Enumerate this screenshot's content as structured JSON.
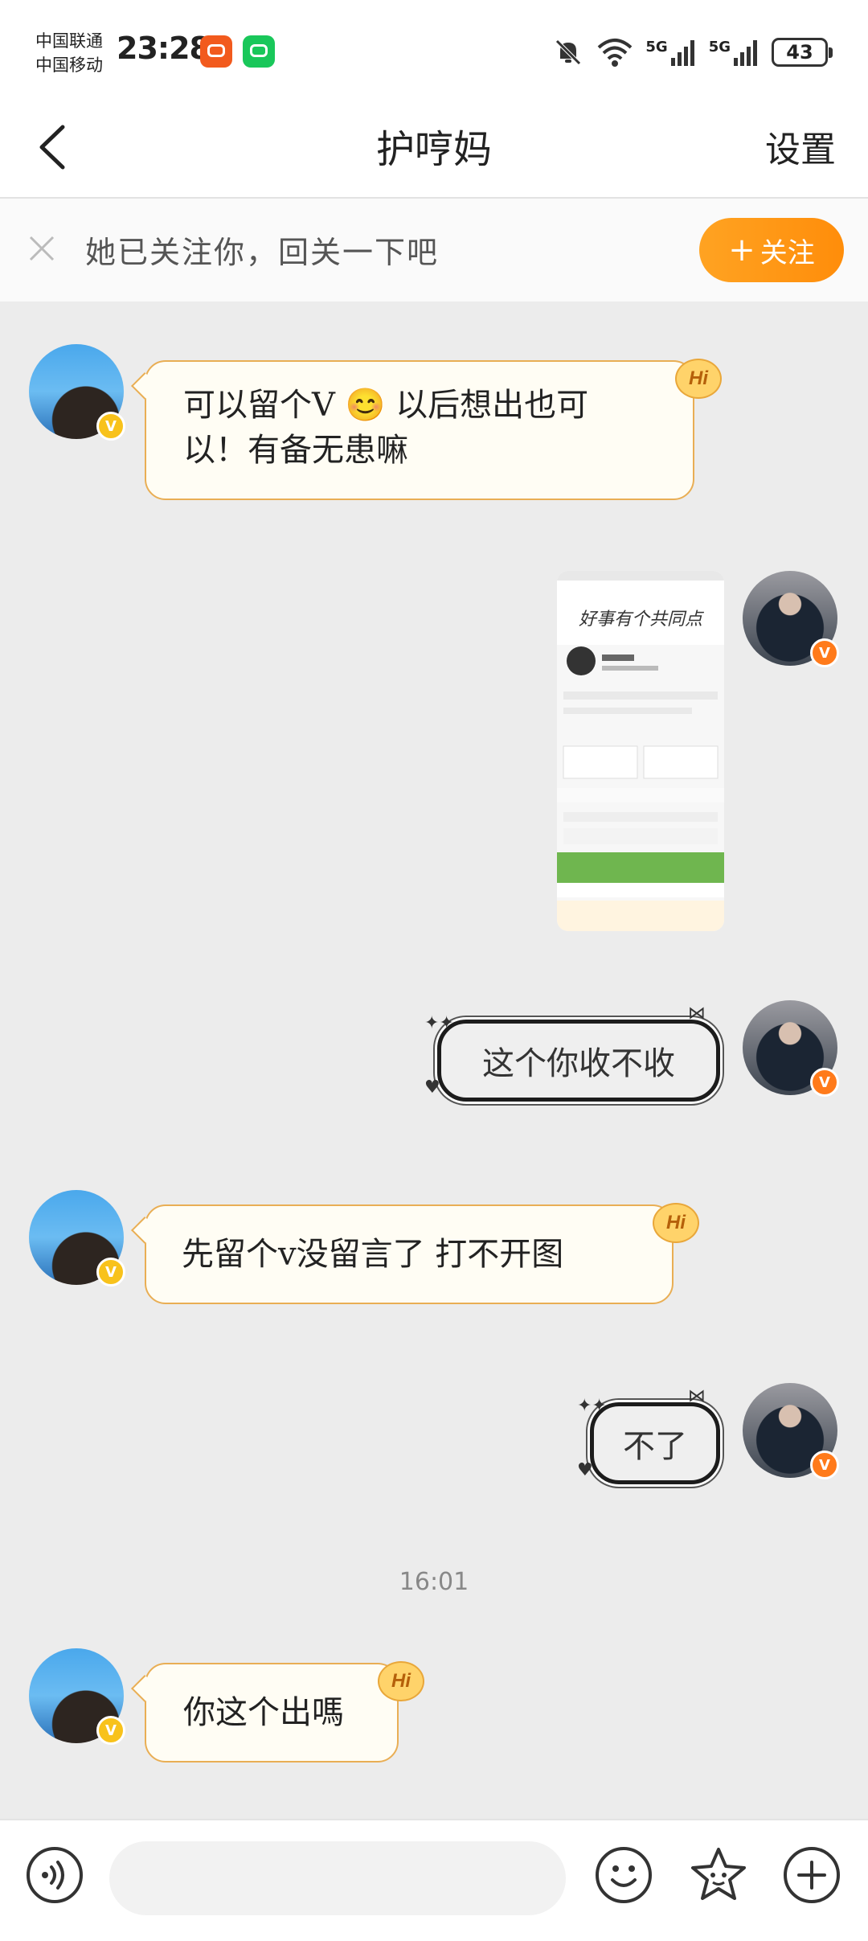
{
  "status_bar": {
    "carrier_1": "中国联通",
    "carrier_2": "中国移动",
    "time": "23:28",
    "network_1": "5G",
    "network_2": "5G",
    "battery": "43"
  },
  "header": {
    "title": "护哼妈",
    "settings_label": "设置"
  },
  "follow_banner": {
    "text": "她已关注你，回关一下吧",
    "button_label": "关注"
  },
  "messages": [
    {
      "side": "left",
      "text_line_1": "可以留个V",
      "emoji": "😊",
      "text_line_1b": "以后想出也可",
      "text_line_2": "以！有备无患嘛",
      "badge": "Hi"
    },
    {
      "side": "right",
      "type": "image",
      "image_caption": "好事有个共同点"
    },
    {
      "side": "right",
      "text": "这个你收不收"
    },
    {
      "side": "left",
      "text": "先留个v没留言了 打不开图",
      "badge": "Hi"
    },
    {
      "side": "right",
      "text": "不了"
    },
    {
      "side": "left",
      "text": "你这个出嗎",
      "badge": "Hi"
    }
  ],
  "timestamp": "16:01",
  "input_bar": {
    "placeholder": ""
  },
  "colors": {
    "accent_orange": "#ff8d0a",
    "bubble_left_border": "#e9ae54",
    "bubble_left_bg": "#fffdf4",
    "chat_bg": "#ececec"
  },
  "icons": {
    "back": "chevron-left-icon",
    "mute": "bell-off-icon",
    "wifi": "wifi-icon",
    "voice": "voice-icon",
    "emoji": "smile-icon",
    "sticker": "star-face-icon",
    "add": "plus-circle-icon"
  }
}
